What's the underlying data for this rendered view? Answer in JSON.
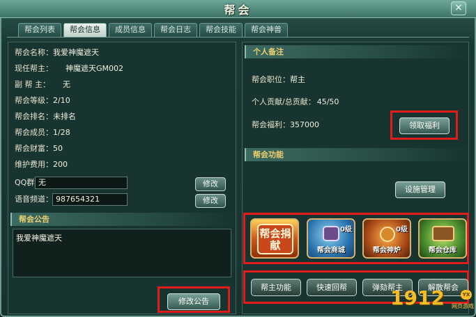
{
  "window": {
    "title": "帮会",
    "close_label": "×"
  },
  "tabs": [
    "帮会列表",
    "帮会信息",
    "成员信息",
    "帮会日志",
    "帮会技能",
    "帮会神兽"
  ],
  "guild_info": {
    "name": {
      "label": "帮会名称：",
      "value": "我爱神魔遮天"
    },
    "leader": {
      "label": "现任帮主：",
      "value": "神魔遮天GM002"
    },
    "deputy": {
      "label": "副 帮 主：",
      "value": "无"
    },
    "level": {
      "label": "帮会等级：",
      "value": "2/10"
    },
    "rank": {
      "label": "帮会排名：",
      "value": "未排名"
    },
    "members": {
      "label": "帮会成员：",
      "value": "1/28"
    },
    "wealth": {
      "label": "帮会财富：",
      "value": "50"
    },
    "upkeep": {
      "label": "维护费用：",
      "value": "200"
    },
    "qq": {
      "label": "QQ群：",
      "value": "无"
    },
    "voice": {
      "label": "语音频道：",
      "value": "987654321"
    },
    "edit_label": "修改"
  },
  "notice": {
    "title": "帮会公告",
    "text": "我爱神魔遮天",
    "edit_button": "修改公告"
  },
  "personal": {
    "title": "个人备注",
    "position": {
      "label": "帮会职位：",
      "value": "帮主"
    },
    "contribution": {
      "label": "个人贡献/总贡献：",
      "value": "45/50"
    },
    "welfare": {
      "label": "帮会福利：",
      "value": "357000"
    },
    "claim_button": "领取福利"
  },
  "functions": {
    "title": "帮会功能",
    "facility_button": "设施管理",
    "icons": [
      {
        "label": "帮会捐献",
        "level": ""
      },
      {
        "label": "帮会商城",
        "level": "0级"
      },
      {
        "label": "帮会神炉",
        "level": "0级"
      },
      {
        "label": "帮会仓库",
        "level": ""
      }
    ],
    "buttons": [
      "帮主功能",
      "快速回帮",
      "弹劾帮主",
      "解散帮会"
    ]
  },
  "watermark": {
    "main": "1912",
    "badge": "YX",
    "sub": "网页游戏"
  }
}
